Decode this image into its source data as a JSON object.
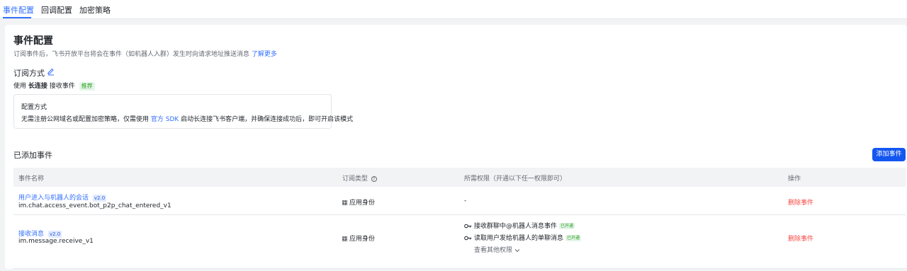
{
  "tabs": [
    {
      "label": "事件配置",
      "active": true
    },
    {
      "label": "回调配置",
      "active": false
    },
    {
      "label": "加密策略",
      "active": false
    }
  ],
  "header": {
    "title": "事件配置",
    "desc": "订阅事件后，飞书开放平台将会在事件（如机器人入群）发生时向请求地址推送消息",
    "learn_more": "了解更多"
  },
  "subscription": {
    "title": "订阅方式",
    "prefix": "使用",
    "mode": "长连接",
    "suffix": "接收事件",
    "recommend_tag": "推荐"
  },
  "config": {
    "title": "配置方式",
    "desc_before": "无需注册公网域名或配置加密策略，仅需使用",
    "sdk_link": "官方 SDK",
    "desc_after": "启动长连接飞书客户端，并确保连接成功后，即可开启该模式"
  },
  "events_section": {
    "title": "已添加事件",
    "add_button": "添加事件"
  },
  "table": {
    "columns": {
      "name": "事件名称",
      "type": "订阅类型",
      "perm": "所需权限（开通以下任一权限即可）",
      "ops": "操作"
    },
    "rows": [
      {
        "name": "用户进入与机器人的会话",
        "version": "v2.0",
        "key": "im.chat.access_event.bot_p2p_chat_entered_v1",
        "type": "应用身份",
        "perm_empty": "-",
        "delete": "删除事件"
      },
      {
        "name": "接收消息",
        "version": "v2.0",
        "key": "im.message.receive_v1",
        "type": "应用身份",
        "perms": [
          {
            "label": "接收群聊中@机器人消息事件",
            "status": "已开通"
          },
          {
            "label": "读取用户发给机器人的单聊消息",
            "status": "已开通"
          }
        ],
        "more": "查看其他权限",
        "delete": "删除事件"
      }
    ]
  },
  "colors": {
    "accent": "#3370ff",
    "primary_button": "#1456f0",
    "danger": "#f54a45",
    "success": "#2ea121"
  }
}
